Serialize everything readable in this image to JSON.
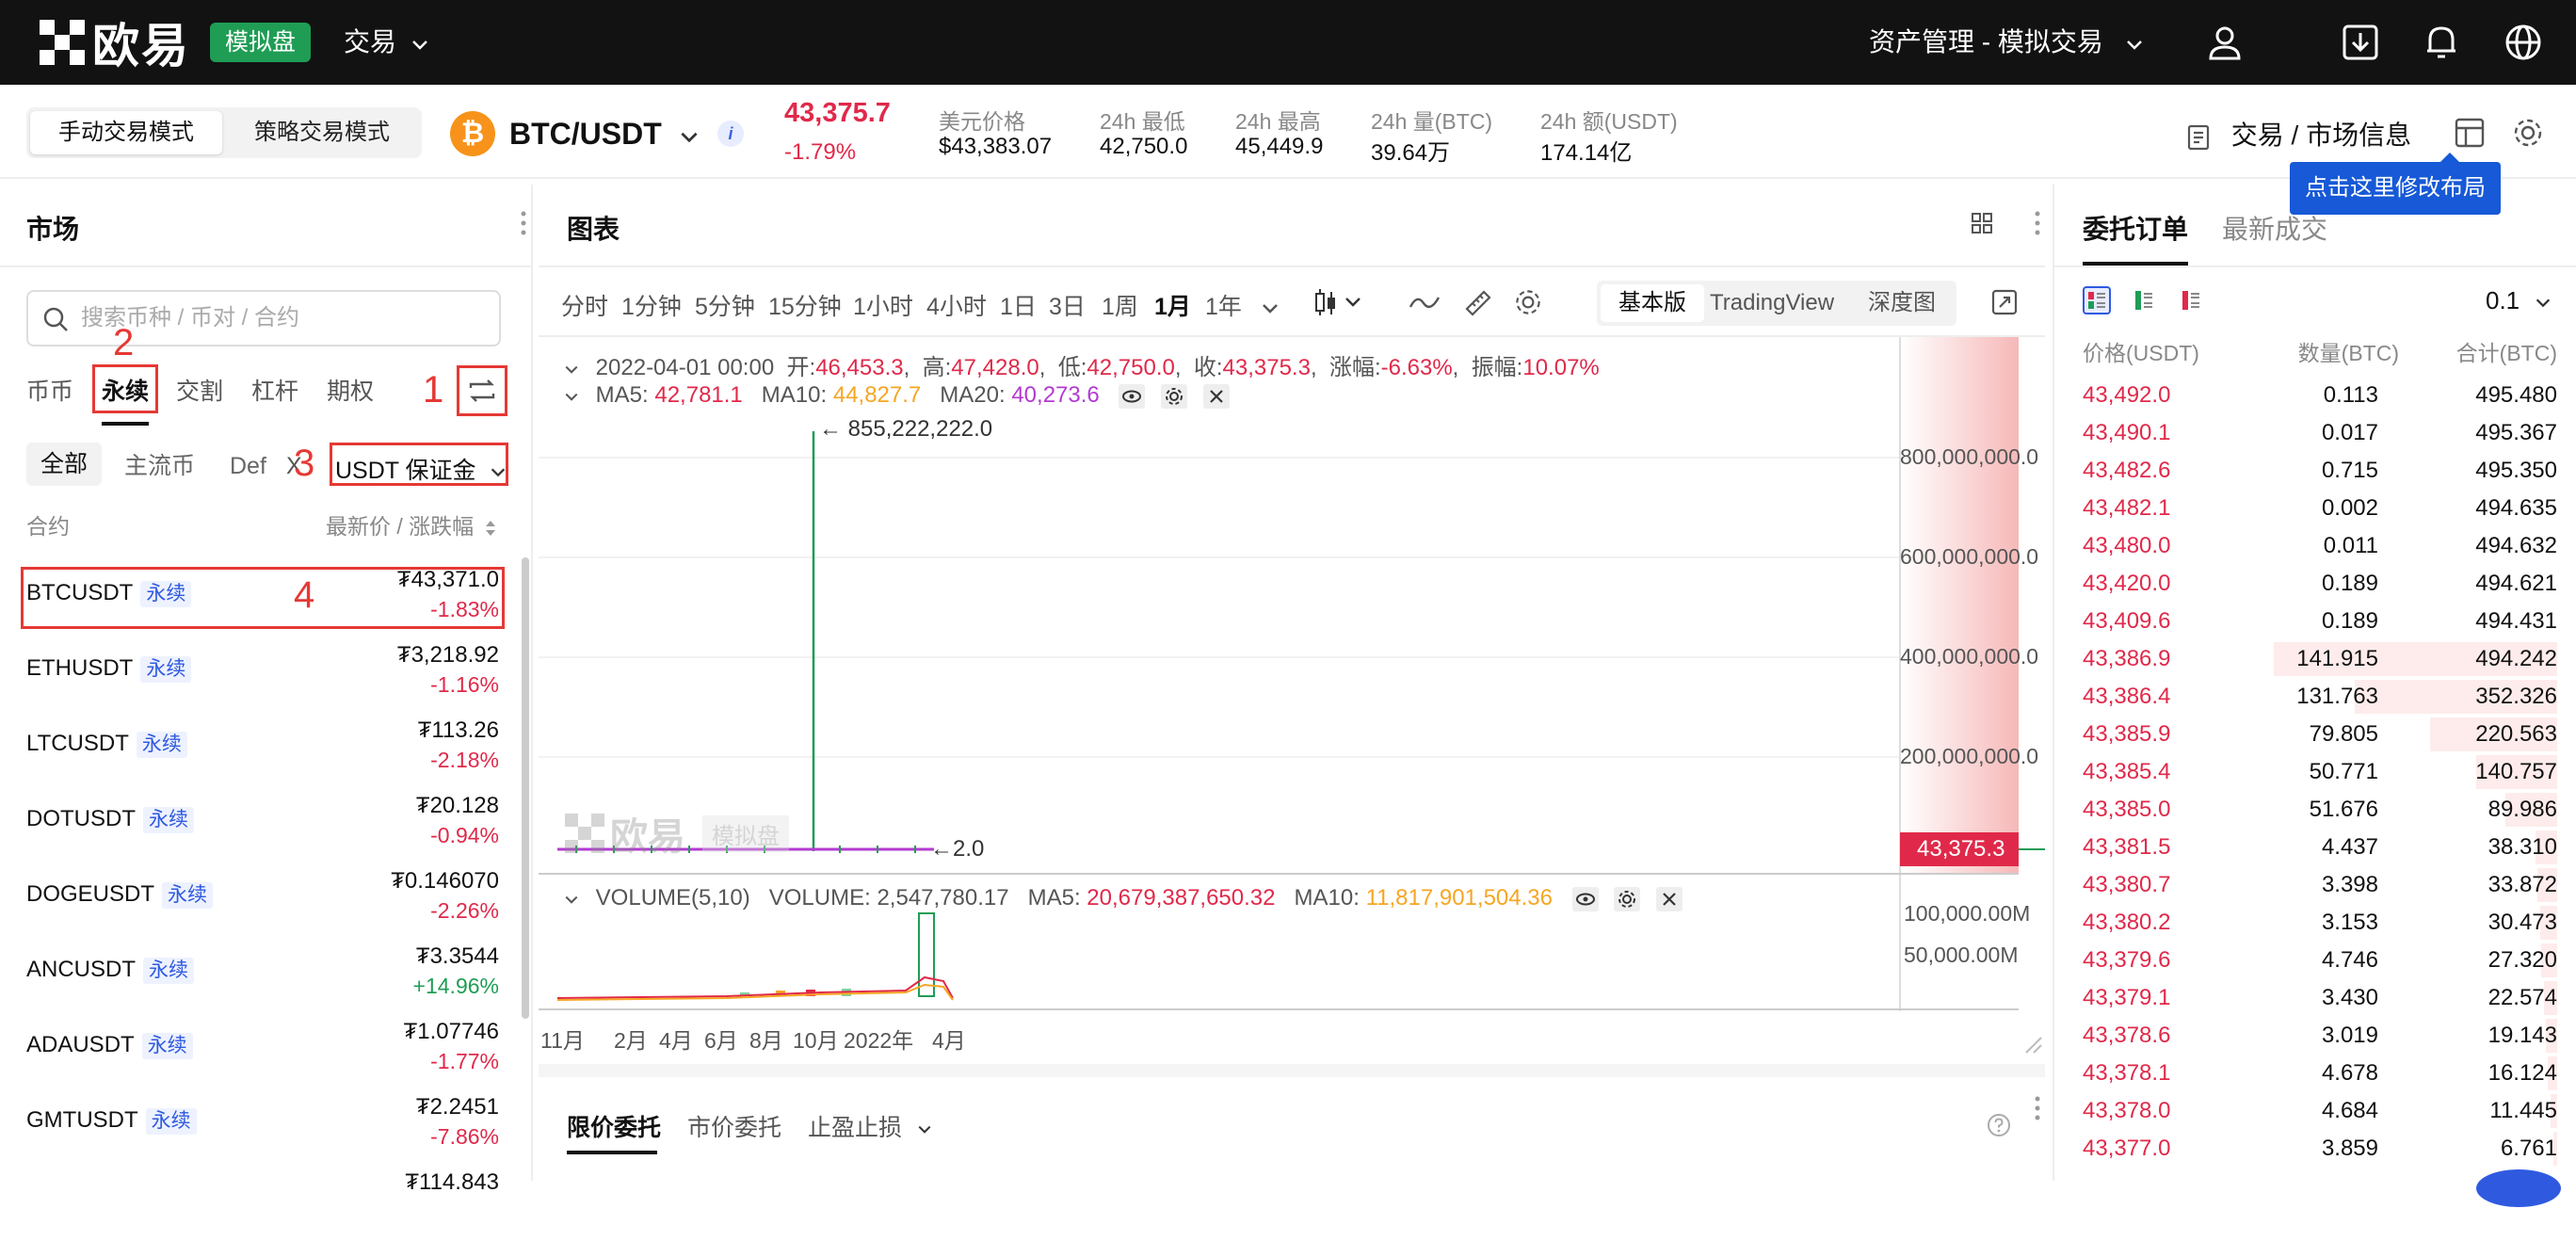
{
  "topbar": {
    "logo_text": "欧易",
    "demo_badge": "模拟盘",
    "trade_menu": "交易",
    "asset_menu": "资产管理 - 模拟交易"
  },
  "header": {
    "mode_manual": "手动交易模式",
    "mode_strategy": "策略交易模式",
    "pair_icon": "₿",
    "pair_name": "BTC/USDT",
    "info_icon": "i",
    "last_price": "43,375.7",
    "last_change": "-1.79%",
    "stats": [
      {
        "label": "美元价格",
        "value": "$43,383.07"
      },
      {
        "label": "24h 最低",
        "value": "42,750.0"
      },
      {
        "label": "24h 最高",
        "value": "45,449.9"
      },
      {
        "label": "24h 量(BTC)",
        "value": "39.64万"
      },
      {
        "label": "24h 额(USDT)",
        "value": "174.14亿"
      }
    ],
    "market_info": "交易 / 市场信息",
    "tooltip": "点击这里修改布局"
  },
  "market": {
    "title": "市场",
    "search_placeholder": "搜索币种 / 币对 / 合约",
    "tabs": [
      "币币",
      "永续",
      "交割",
      "杠杆",
      "期权"
    ],
    "annotations": [
      "1",
      "2",
      "3",
      "4"
    ],
    "filters": [
      "全部",
      "主流币",
      "Def"
    ],
    "filter_close": "X",
    "usdt_margin": "USDT 保证金",
    "col_contract": "合约",
    "col_price": "最新价 / 涨跌幅",
    "rows": [
      {
        "symbol": "BTCUSDT",
        "tag": "永续",
        "price": "₮43,371.0",
        "change": "-1.83%",
        "dir": "neg"
      },
      {
        "symbol": "ETHUSDT",
        "tag": "永续",
        "price": "₮3,218.92",
        "change": "-1.16%",
        "dir": "neg"
      },
      {
        "symbol": "LTCUSDT",
        "tag": "永续",
        "price": "₮113.26",
        "change": "-2.18%",
        "dir": "neg"
      },
      {
        "symbol": "DOTUSDT",
        "tag": "永续",
        "price": "₮20.128",
        "change": "-0.94%",
        "dir": "neg"
      },
      {
        "symbol": "DOGEUSDT",
        "tag": "永续",
        "price": "₮0.146070",
        "change": "-2.26%",
        "dir": "neg"
      },
      {
        "symbol": "ANCUSDT",
        "tag": "永续",
        "price": "₮3.3544",
        "change": "+14.96%",
        "dir": "pos"
      },
      {
        "symbol": "ADAUSDT",
        "tag": "永续",
        "price": "₮1.07746",
        "change": "-1.77%",
        "dir": "neg"
      },
      {
        "symbol": "GMTUSDT",
        "tag": "永续",
        "price": "₮2.2451",
        "change": "-7.86%",
        "dir": "neg"
      },
      {
        "symbol": "",
        "tag": "",
        "price": "₮114.843",
        "change": "",
        "dir": "neg"
      }
    ]
  },
  "chart": {
    "title": "图表",
    "timeframes": [
      "分时",
      "1分钟",
      "5分钟",
      "15分钟",
      "1小时",
      "4小时",
      "1日",
      "3日",
      "1周",
      "1月",
      "1年"
    ],
    "active_timeframe": "1月",
    "views": [
      "基本版",
      "TradingView",
      "深度图"
    ],
    "ohlc": {
      "date": "2022-04-01 00:00",
      "open_label": "开:",
      "open": "46,453.3",
      "high_label": "高:",
      "high": "47,428.0",
      "low_label": "低:",
      "low": "42,750.0",
      "close_label": "收:",
      "close": "43,375.3",
      "change_label": "涨幅:",
      "change": "-6.63%",
      "amp_label": "振幅:",
      "amp": "10.07%"
    },
    "ma": {
      "ma5_label": "MA5:",
      "ma5": "42,781.1",
      "ma10_label": "MA10:",
      "ma10": "44,827.7",
      "ma20_label": "MA20:",
      "ma20": "40,273.6"
    },
    "volume": {
      "name": "VOLUME(5,10)",
      "vol_label": "VOLUME:",
      "vol": "2,547,780.17",
      "ma5_label": "MA5:",
      "ma5": "20,679,387,650.32",
      "ma10_label": "MA10:",
      "ma10": "11,817,901,504.36"
    },
    "peak_label": "← 855,222,222.0",
    "low_label": "←2.0",
    "y_ticks": [
      "800,000,000.0",
      "600,000,000.0",
      "400,000,000.0",
      "200,000,000.0"
    ],
    "current_price_tag": "43,375.3",
    "vol_ticks": [
      "100,000.00M",
      "50,000.00M"
    ],
    "x_ticks": [
      "11月",
      "2月",
      "4月",
      "6月",
      "8月",
      "10月",
      "2022年",
      "4月"
    ],
    "watermark": "欧易",
    "watermark_badge": "模拟盘"
  },
  "order_form": {
    "tabs": [
      "限价委托",
      "市价委托",
      "止盈止损"
    ]
  },
  "orderbook": {
    "tabs": [
      "委托订单",
      "最新成交"
    ],
    "precision": "0.1",
    "col_price": "价格(USDT)",
    "col_qty": "数量(BTC)",
    "col_total": "合计(BTC)",
    "asks": [
      {
        "price": "43,492.0",
        "qty": "0.113",
        "total": "495.480",
        "depth": 1.0
      },
      {
        "price": "43,490.1",
        "qty": "0.017",
        "total": "495.367",
        "depth": 1.0
      },
      {
        "price": "43,482.6",
        "qty": "0.715",
        "total": "495.350",
        "depth": 1.0
      },
      {
        "price": "43,482.1",
        "qty": "0.002",
        "total": "494.635",
        "depth": 0.998
      },
      {
        "price": "43,480.0",
        "qty": "0.011",
        "total": "494.632",
        "depth": 0.998
      },
      {
        "price": "43,420.0",
        "qty": "0.189",
        "total": "494.621",
        "depth": 0.998
      },
      {
        "price": "43,409.6",
        "qty": "0.189",
        "total": "494.431",
        "depth": 0.998
      },
      {
        "price": "43,386.9",
        "qty": "141.915",
        "total": "494.242",
        "depth": 0.997
      },
      {
        "price": "43,386.4",
        "qty": "131.763",
        "total": "352.326",
        "depth": 0.711
      },
      {
        "price": "43,385.9",
        "qty": "79.805",
        "total": "220.563",
        "depth": 0.445
      },
      {
        "price": "43,385.4",
        "qty": "50.771",
        "total": "140.757",
        "depth": 0.284
      },
      {
        "price": "43,385.0",
        "qty": "51.676",
        "total": "89.986",
        "depth": 0.182
      },
      {
        "price": "43,381.5",
        "qty": "4.437",
        "total": "38.310",
        "depth": 0.077
      },
      {
        "price": "43,380.7",
        "qty": "3.398",
        "total": "33.872",
        "depth": 0.068
      },
      {
        "price": "43,380.2",
        "qty": "3.153",
        "total": "30.473",
        "depth": 0.061
      },
      {
        "price": "43,379.6",
        "qty": "4.746",
        "total": "27.320",
        "depth": 0.055
      },
      {
        "price": "43,379.1",
        "qty": "3.430",
        "total": "22.574",
        "depth": 0.046
      },
      {
        "price": "43,378.6",
        "qty": "3.019",
        "total": "19.143",
        "depth": 0.039
      },
      {
        "price": "43,378.1",
        "qty": "4.678",
        "total": "16.124",
        "depth": 0.033
      },
      {
        "price": "43,378.0",
        "qty": "4.684",
        "total": "11.445",
        "depth": 0.023
      },
      {
        "price": "43,377.0",
        "qty": "3.859",
        "total": "6.761",
        "depth": 0.014
      }
    ]
  },
  "colors": {
    "up": "#1f9d55",
    "down": "#e0294a",
    "accent": "#1759d6",
    "annotation": "#e53935"
  }
}
